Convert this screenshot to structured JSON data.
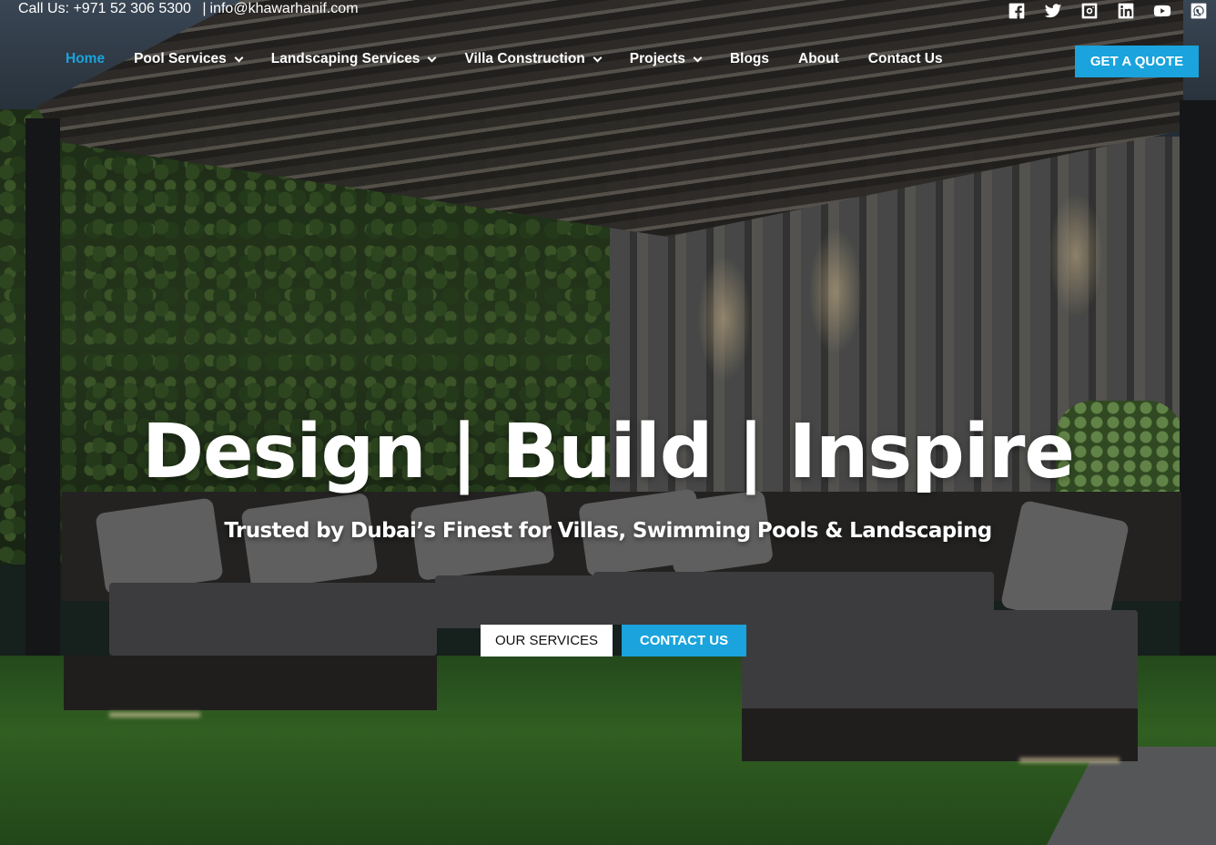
{
  "topbar": {
    "phone": "Call Us: +971 52 306 5300",
    "separator": "|",
    "email": "info@khawarhanif.com",
    "socials": [
      {
        "icon": "facebook-icon"
      },
      {
        "icon": "twitter-icon"
      },
      {
        "icon": "instagram-icon"
      },
      {
        "icon": "linkedin-icon"
      },
      {
        "icon": "youtube-icon"
      },
      {
        "icon": "whatsapp-icon"
      }
    ]
  },
  "nav": {
    "items": [
      {
        "label": "Home",
        "active": true,
        "dropdown": false
      },
      {
        "label": "Pool Services",
        "active": false,
        "dropdown": true
      },
      {
        "label": "Landscaping Services",
        "active": false,
        "dropdown": true
      },
      {
        "label": "Villa Construction",
        "active": false,
        "dropdown": true
      },
      {
        "label": "Projects",
        "active": false,
        "dropdown": true
      },
      {
        "label": "Blogs",
        "active": false,
        "dropdown": false
      },
      {
        "label": "About",
        "active": false,
        "dropdown": false
      },
      {
        "label": "Contact Us",
        "active": false,
        "dropdown": false
      }
    ],
    "quote_label": "GET A QUOTE"
  },
  "hero": {
    "title": "Design | Build | Inspire",
    "subtitle": "Trusted by Dubai’s Finest for Villas, Swimming Pools & Landscaping",
    "primary_button": "OUR SERVICES",
    "secondary_button": "CONTACT US"
  },
  "colors": {
    "accent": "#1aa3dc",
    "text": "#ffffff"
  }
}
